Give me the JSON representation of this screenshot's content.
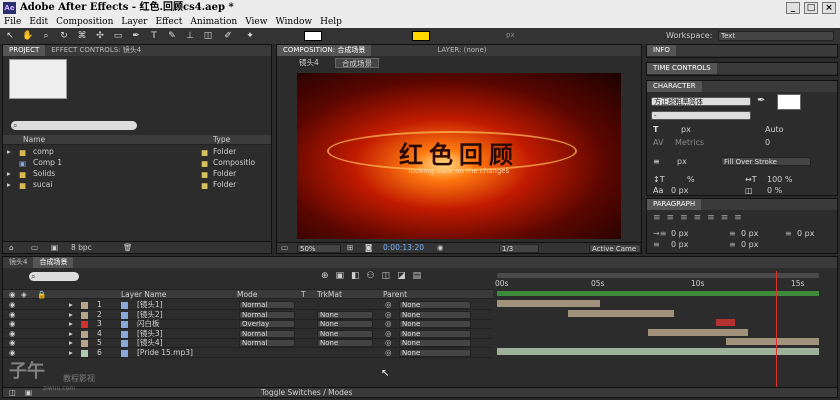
{
  "app": {
    "title": "Adobe After Effects - 红色.回顾cs4.aep *",
    "logo": "Ae"
  },
  "menu": [
    "File",
    "Edit",
    "Composition",
    "Layer",
    "Effect",
    "Animation",
    "View",
    "Window",
    "Help"
  ],
  "toolbar": {
    "px_value": "px",
    "workspace_label": "Workspace:",
    "workspace_value": "Text"
  },
  "project": {
    "tabs": [
      "PROJECT",
      "EFFECT CONTROLS: 镜头4"
    ],
    "search_placeholder": "",
    "columns": [
      "Name",
      "Type"
    ],
    "items": [
      {
        "name": "comp",
        "type": "Folder"
      },
      {
        "name": "Comp 1",
        "type": "Compositio"
      },
      {
        "name": "Solids",
        "type": "Folder"
      },
      {
        "name": "sucai",
        "type": "Folder"
      }
    ],
    "bpc": "8 bpc"
  },
  "composition": {
    "tab": "COMPOSITION: 合成场景",
    "layer_tab": "LAYER: (none)",
    "breadcrumbs": [
      "镜头4",
      "合成场景"
    ],
    "preview_title": "红色回顾",
    "preview_subtitle": "looking back on the changes",
    "zoom": "50%",
    "timecode": "0:00:13:20",
    "resolution": "1/3",
    "view": "Active Came"
  },
  "right": {
    "info": "INFO",
    "time_controls": "TIME CONTROLS",
    "character": "CHARACTER",
    "paragraph": "PARAGRAPH",
    "font": "方正超粗黑简体",
    "font_style": "-",
    "size": "px",
    "leading": "Auto",
    "tracking_label": "Metrics",
    "tracking": "0",
    "stroke_size": "px",
    "stroke_mode": "Fill Over Stroke",
    "vscale": "%",
    "hscale": "100 %",
    "baseline": "0 px",
    "tsume": "0 %",
    "indent": [
      "0 px",
      "0 px",
      "0 px",
      "0 px",
      "0 px"
    ]
  },
  "timeline": {
    "tabs": [
      "镜头4",
      "合成场景"
    ],
    "search_placeholder": "",
    "headers": {
      "layer_name": "Layer Name",
      "mode": "Mode",
      "t": "T",
      "trkmat": "TrkMat",
      "parent": "Parent"
    },
    "ruler": [
      "00s",
      "05s",
      "10s",
      "15s"
    ],
    "playhead_fraction": 0.865,
    "layers": [
      {
        "num": "1",
        "name": "[镜头1]",
        "mode": "Normal",
        "trkmat": "",
        "parent": "None",
        "color": "#b5a48a",
        "start": 0.0,
        "end": 0.32
      },
      {
        "num": "2",
        "name": "[镜头2]",
        "mode": "Normal",
        "trkmat": "None",
        "parent": "None",
        "color": "#b5a48a",
        "start": 0.22,
        "end": 0.55
      },
      {
        "num": "3",
        "name": "闪白板",
        "mode": "Overlay",
        "trkmat": "None",
        "parent": "None",
        "color": "#c33",
        "start": 0.68,
        "end": 0.74
      },
      {
        "num": "4",
        "name": "[镜头3]",
        "mode": "Normal",
        "trkmat": "None",
        "parent": "None",
        "color": "#b5a48a",
        "start": 0.47,
        "end": 0.78
      },
      {
        "num": "5",
        "name": "[镜头4]",
        "mode": "Normal",
        "trkmat": "None",
        "parent": "None",
        "color": "#b5a48a",
        "start": 0.71,
        "end": 1.0
      },
      {
        "num": "6",
        "name": "[Pride 15.mp3]",
        "mode": "",
        "trkmat": "",
        "parent": "None",
        "color": "#b0c8b0",
        "start": 0.0,
        "end": 1.0
      }
    ],
    "toggle_label": "Toggle Switches / Modes"
  },
  "watermark": {
    "cn": "子午",
    "sub": "教程影视",
    "url": "ziwuu.com"
  }
}
